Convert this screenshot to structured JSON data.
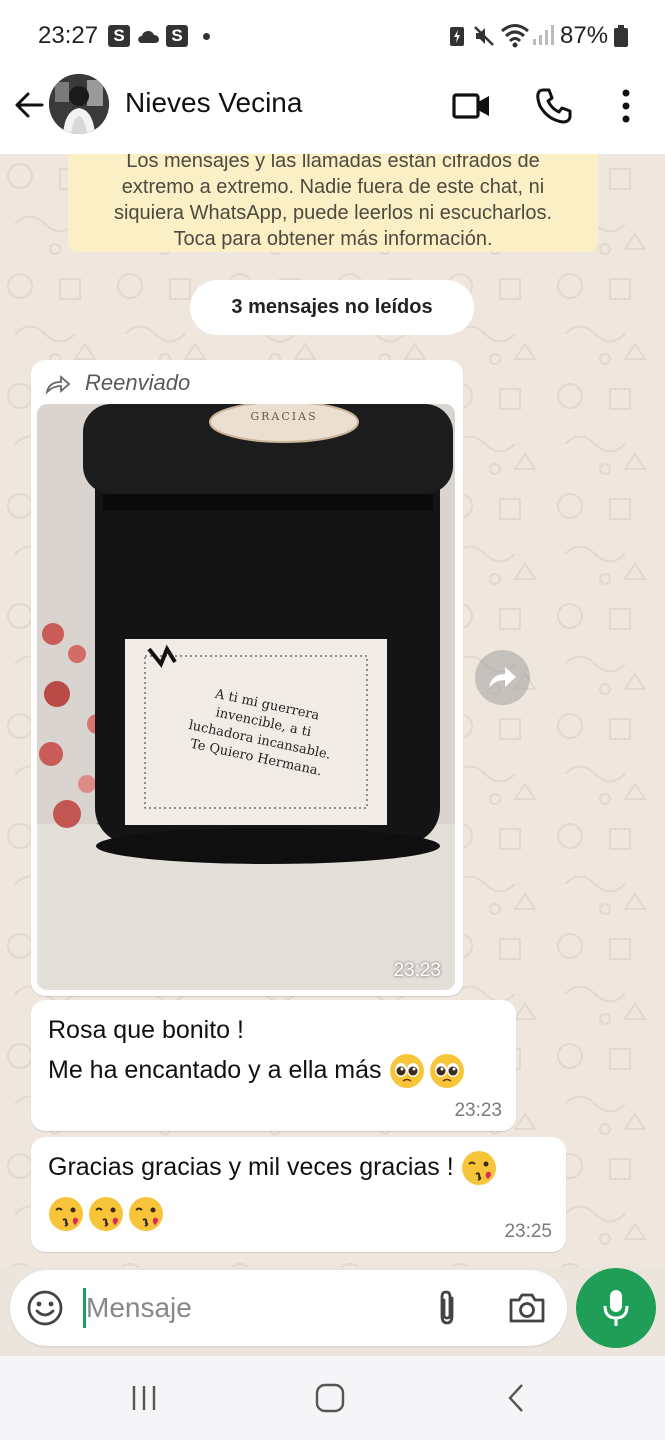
{
  "status_bar": {
    "time": "23:27",
    "badges": [
      "S",
      "S"
    ],
    "battery": "87%"
  },
  "header": {
    "contact_name": "Nieves Vecina",
    "icons": [
      "back-arrow-icon",
      "video-call-icon",
      "phone-icon",
      "more-vert-icon"
    ]
  },
  "chat": {
    "encryption_notice": [
      "Los mensajes y las llamadas están cifrados de",
      "extremo a extremo. Nadie fuera de este chat, ni",
      "siquiera WhatsApp, puede leerlos ni escucharlos.",
      "Toca para obtener más información."
    ],
    "unread_label": "3 mensajes no leídos",
    "messages": [
      {
        "type": "image",
        "forwarded_label": "Reenviado",
        "label_text": [
          "A ti mi guerrera",
          "invencible, a ti",
          "luchadora incansable.",
          "Te Quiero Hermana."
        ],
        "lid_text": "GRACIAS",
        "time": "23:23"
      },
      {
        "type": "text",
        "lines": [
          "Rosa  que bonito !",
          "Me ha encantado y a ella más"
        ],
        "emojis": [
          "pleading-face",
          "pleading-face"
        ],
        "time": "23:23"
      },
      {
        "type": "text",
        "lines": [
          "Gracias gracias y mil veces gracias !"
        ],
        "emojis_inline": [
          "face-blowing-kiss"
        ],
        "emojis_line2": [
          "face-blowing-kiss",
          "face-blowing-kiss",
          "face-blowing-kiss"
        ],
        "time": "23:25"
      }
    ]
  },
  "input": {
    "placeholder": "Mensaje"
  },
  "colors": {
    "accent_green": "#1f9e58",
    "notice_bg": "#fbefc6",
    "chat_bg": "#efe7dd"
  }
}
